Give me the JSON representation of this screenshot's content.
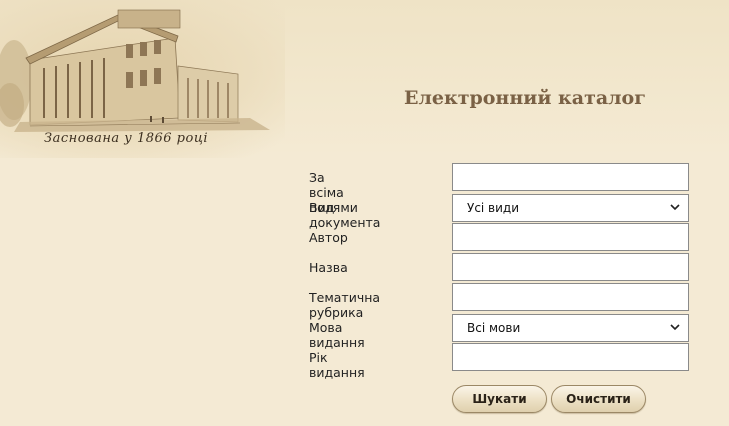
{
  "header": {
    "founded_text": "Заснована у 1866 році",
    "title": "Електронний каталог"
  },
  "form": {
    "fields": [
      {
        "label": "За всіма полями",
        "type": "text",
        "value": ""
      },
      {
        "label": "Вид документа",
        "type": "select",
        "value": "Усі види"
      },
      {
        "label": "Автор",
        "type": "text",
        "value": ""
      },
      {
        "label": "Назва",
        "type": "text",
        "value": ""
      },
      {
        "label": "Тематична рубрика",
        "type": "text",
        "value": ""
      },
      {
        "label": "Мова видання",
        "type": "select",
        "value": "Всі мови"
      },
      {
        "label": "Рік видання",
        "type": "text",
        "value": ""
      }
    ],
    "search_label": "Шукати",
    "clear_label": "Очистити"
  },
  "colors": {
    "background": "#f4ead4",
    "title": "#7a6145",
    "button_border": "#9b8866"
  },
  "icons": {
    "banner": "library-building-engraving",
    "select_arrow": "chevron-down-icon"
  }
}
